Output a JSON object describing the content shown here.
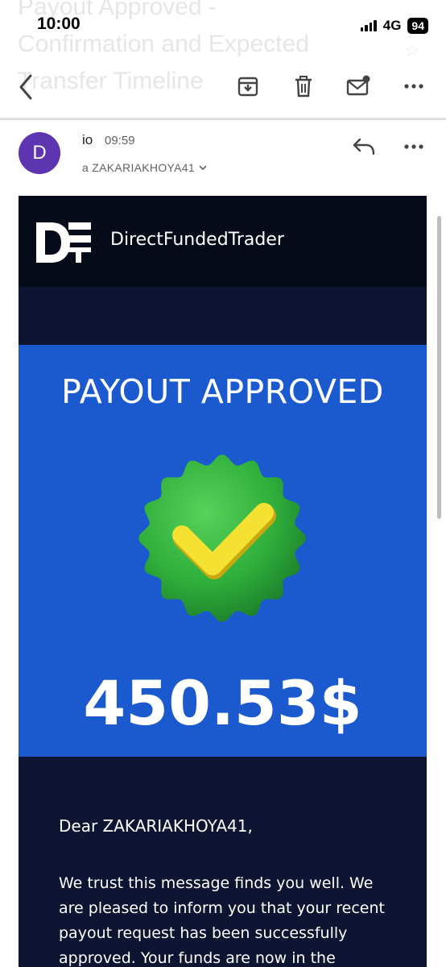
{
  "status_bar": {
    "time": "10:00",
    "network": "4G",
    "battery": "94"
  },
  "subject_lines": [
    "Payout Approved -",
    "Confirmation and Expected",
    "Transfer Timeline"
  ],
  "toolbar": {
    "back_icon": "chevron-left-icon",
    "archive_icon": "archive-icon",
    "delete_icon": "trash-icon",
    "unread_icon": "mail-unread-icon",
    "more_icon": "more-horizontal-icon"
  },
  "message": {
    "avatar_letter": "D",
    "avatar_color": "#5e35b1",
    "sender": "io",
    "time": "09:59",
    "recipient": "a ZAKARIAKHOYA41"
  },
  "email": {
    "brand_name": "DirectFundedTrader",
    "title": "PAYOUT APPROVED",
    "amount": "450.53$",
    "greeting": "Dear ZAKARIAKHOYA41,",
    "paragraph": "We trust this message finds you well. We are pleased to inform you that your recent payout request has been successfully approved. Your funds are now in the process of being",
    "colors": {
      "header": "#060b19",
      "panel": "#1b59cf",
      "body": "#0d1533",
      "badge": "#2fae3b",
      "check": "#f4e132"
    }
  }
}
